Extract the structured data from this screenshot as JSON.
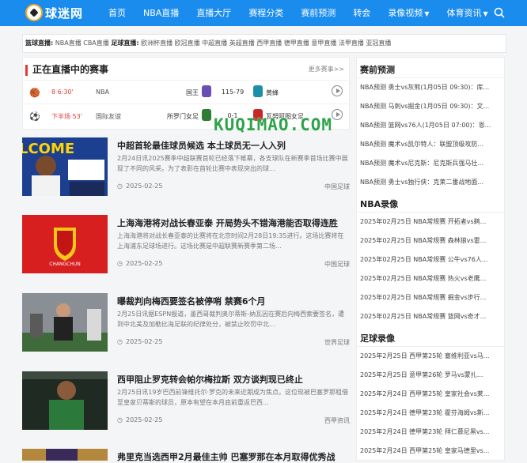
{
  "header": {
    "logo": "球迷网",
    "nav": [
      "首页",
      "NBA直播",
      "直播大厅",
      "赛程分类",
      "赛前预测",
      "转会",
      "录像视频",
      "体育资讯"
    ]
  },
  "ticker": {
    "basketball_label": "篮球直播:",
    "basketball_items": "NBA直播 CBA直播",
    "football_label": "足球直播:",
    "football_items": "欧洲杯直播 欧冠直播 中超直播 英超直播 西甲直播 德甲直播 意甲直播 法甲直播 亚冠直播"
  },
  "live": {
    "title": "正在直播中的赛事",
    "more": "更多赛事>>",
    "matches": [
      {
        "time": "8 6:30'",
        "league": "NBA",
        "home": "国王",
        "score": "115-79",
        "away": "黄蜂",
        "home_color": "#6a4fb3",
        "away_color": "#1d8ea8"
      },
      {
        "time": "下半场 53'",
        "league": "国际友谊",
        "home": "所罗门女足",
        "score": "0-1",
        "away": "瓦努阿图女足",
        "home_color": "#2e7d32",
        "away_color": "#c62828"
      }
    ]
  },
  "watermark": "KUQIMAO.COM",
  "news": [
    {
      "title": "中超首轮最佳球员候选 本土球员无一人入列",
      "summary": "2月24日讯2025赛季中超联赛首轮已经落下帷幕，各支球队在新赛季首场比赛中展现了不同的风采。为了表彰在首轮比赛中表现突出的球...",
      "date": "2025-02-25",
      "tag": "中国足球"
    },
    {
      "title": "上海海港将对战长春亚泰 开局势头不错海港能否取得连胜",
      "summary": "上海海港将对战长春亚泰的比赛将在北京时间2月28日19:35进行。这场比赛将在上海浦东足球场进行。这场比赛是中超联赛新赛季第二场...",
      "date": "2025-02-25",
      "tag": "中国足球"
    },
    {
      "title": "曝裁判向梅西要签名被停哨 禁赛6个月",
      "summary": "2月25日讯据ESPN报道，墨西哥裁判奥尔蒂斯-纳瓦因在赛后向梅西索要签名，遭到中北美及加勒比海足联的纪律处分，被禁止吹罚中北...",
      "date": "2025-02-25",
      "tag": "世界足球"
    },
    {
      "title": "西甲阻止罗克转会帕尔梅拉斯 双方谈判现已终止",
      "summary": "2月25日讯19岁巴西前锋维托尔·罗克的未来近期成为焦点。这位现被巴塞罗那租借至皇家贝蒂斯的球员，原本有望在本月底前重返巴西...",
      "date": "2025-02-25",
      "tag": "西甲资讯"
    },
    {
      "title": "弗里克当选西甲2月最佳主帅 巴塞罗那在本月取得优秀战",
      "summary": "",
      "date": "",
      "tag": ""
    }
  ],
  "sidebar": {
    "predict_title": "赛前预测",
    "predict": [
      "NBA预测 勇士vs灰熊(1月05日 09:30)：库...",
      "NBA预测 马刺vs掘金(1月05日 09:30)：文...",
      "NBA预测 篮网vs76人(1月05日 07:00)：恩...",
      "NBA预测 魔术vs凯尔特人：联盟顶级攻防...",
      "NBA预测 魔术vs尼克斯：尼克斯兵强马壮...",
      "NBA预测 勇士vs独行侠：克莱二番战地面..."
    ],
    "nba_title": "NBA录像",
    "nba": [
      "2025年02月25日 NBA常规赛 开拓者vs鹈...",
      "2025年02月25日 NBA常规赛 森林狼vs雷...",
      "2025年02月25日 NBA常规赛 公牛vs76人...",
      "2025年02月25日 NBA常规赛 热火vs老鹰...",
      "2025年02月25日 NBA常规赛 掘金vs步行...",
      "2025年02月25日 NBA常规赛 篮网vs奇才..."
    ],
    "football_title": "足球录像",
    "football": [
      "2025年2月25日 西甲第25轮 塞维利亚vs马...",
      "2025年2月25日 意甲第26轮 罗马vs蒙扎...",
      "2025年2月24日 西甲第25轮 皇家社会vs莱...",
      "2025年2月24日 德甲第23轮 霍芬海姆vs斯...",
      "2025年2月24日 德甲第23轮 拜仁慕尼黑vs...",
      "2025年2月24日 西甲第25轮 皇家马德里vs..."
    ]
  },
  "colors": {
    "brand": "#1a8cee",
    "live_red": "#e03c31",
    "watermark": "#2ea34a"
  }
}
